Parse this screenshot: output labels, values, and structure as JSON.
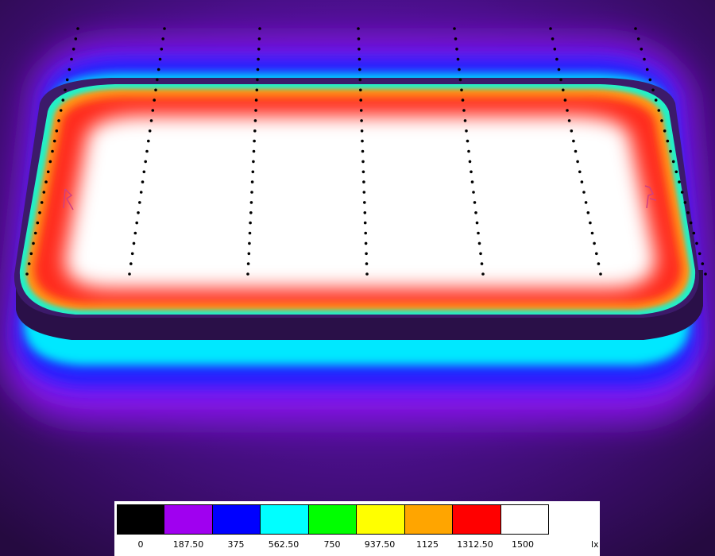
{
  "visualization": {
    "subject": "stadium-illuminance-map",
    "background_color": "#2a0a44"
  },
  "legend": {
    "unit": "lx",
    "colors": [
      "#000000",
      "#a000f0",
      "#0000ff",
      "#00ffff",
      "#00ff00",
      "#ffff00",
      "#ffa500",
      "#ff0000",
      "#ffffff"
    ],
    "ticks": [
      "0",
      "187.50",
      "375",
      "562.50",
      "750",
      "937.50",
      "1125",
      "1312.50",
      "1500"
    ]
  }
}
